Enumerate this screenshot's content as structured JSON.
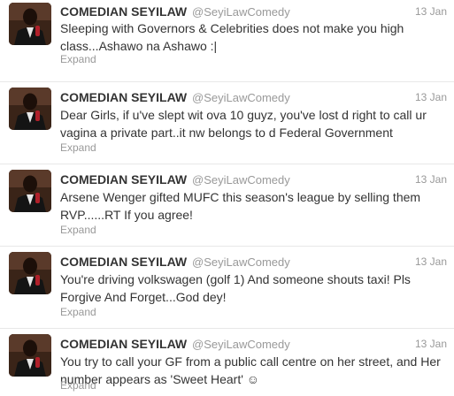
{
  "colors": {
    "name": "#333333",
    "meta": "#999999",
    "divider": "#e8e8e8"
  },
  "tweets": [
    {
      "author_name": "COMEDIAN SEYILAW",
      "handle": "@SeyiLawComedy",
      "time": "13 Jan",
      "text": "Sleeping with Governors & Celebrities does not make you high class...Ashawo na Ashawo :|",
      "expand_label": "Expand",
      "avatar_icon": "profile-photo"
    },
    {
      "author_name": "COMEDIAN SEYILAW",
      "handle": "@SeyiLawComedy",
      "time": "13 Jan",
      "text": "Dear Girls, if u've slept wit ova 10 guyz, you've lost d right to call ur vagina a private part..it nw belongs to d Federal Government",
      "expand_label": "Expand",
      "avatar_icon": "profile-photo"
    },
    {
      "author_name": "COMEDIAN SEYILAW",
      "handle": "@SeyiLawComedy",
      "time": "13 Jan",
      "text": "Arsene Wenger gifted MUFC this season's league by selling them RVP......RT If you agree!",
      "expand_label": "Expand",
      "avatar_icon": "profile-photo"
    },
    {
      "author_name": "COMEDIAN SEYILAW",
      "handle": "@SeyiLawComedy",
      "time": "13 Jan",
      "text": "You're driving volkswagen (golf 1) And someone shouts taxi! Pls Forgive And Forget...God dey!",
      "expand_label": "Expand",
      "avatar_icon": "profile-photo"
    },
    {
      "author_name": "COMEDIAN SEYILAW",
      "handle": "@SeyiLawComedy",
      "time": "13 Jan",
      "text": "You try to call your GF from a public call centre on her street, and Her number appears as 'Sweet Heart' ☺",
      "expand_label": "Expand",
      "avatar_icon": "profile-photo"
    }
  ]
}
